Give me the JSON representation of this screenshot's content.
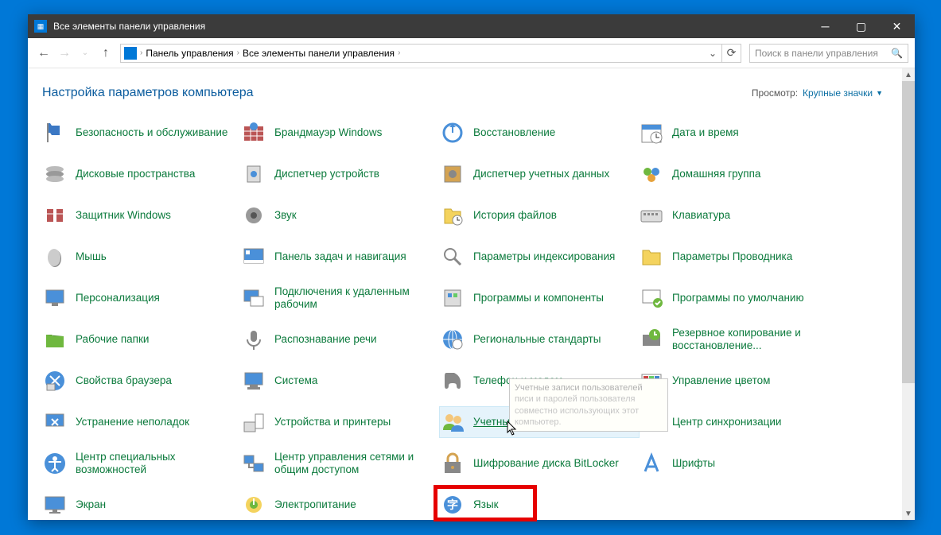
{
  "window": {
    "title": "Все элементы панели управления"
  },
  "breadcrumb": {
    "root": "Панель управления",
    "sub": "Все элементы панели управления"
  },
  "search": {
    "placeholder": "Поиск в панели управления"
  },
  "heading": "Настройка параметров компьютера",
  "view": {
    "label": "Просмотр:",
    "value": "Крупные значки"
  },
  "items": [
    {
      "label": "Безопасность и обслуживание",
      "icon": "flag"
    },
    {
      "label": "Брандмауэр Windows",
      "icon": "firewall"
    },
    {
      "label": "Восстановление",
      "icon": "recovery"
    },
    {
      "label": "Дата и время",
      "icon": "datetime"
    },
    {
      "label": "Дисковые пространства",
      "icon": "disks"
    },
    {
      "label": "Диспетчер устройств",
      "icon": "devmgr"
    },
    {
      "label": "Диспетчер учетных данных",
      "icon": "safe"
    },
    {
      "label": "Домашняя группа",
      "icon": "homegroup"
    },
    {
      "label": "Защитник Windows",
      "icon": "defender"
    },
    {
      "label": "Звук",
      "icon": "sound"
    },
    {
      "label": "История файлов",
      "icon": "filehistory"
    },
    {
      "label": "Клавиатура",
      "icon": "keyboard"
    },
    {
      "label": "Мышь",
      "icon": "mouse"
    },
    {
      "label": "Панель задач и навигация",
      "icon": "taskbar"
    },
    {
      "label": "Параметры индексирования",
      "icon": "index"
    },
    {
      "label": "Параметры Проводника",
      "icon": "folderopt"
    },
    {
      "label": "Персонализация",
      "icon": "personalize"
    },
    {
      "label": "Подключения к удаленным рабочим",
      "icon": "remote"
    },
    {
      "label": "Программы и компоненты",
      "icon": "programs"
    },
    {
      "label": "Программы по умолчанию",
      "icon": "defaultprog"
    },
    {
      "label": "Рабочие папки",
      "icon": "workfolders"
    },
    {
      "label": "Распознавание речи",
      "icon": "speech"
    },
    {
      "label": "Региональные стандарты",
      "icon": "region"
    },
    {
      "label": "Резервное копирование и восстановление...",
      "icon": "backup"
    },
    {
      "label": "Свойства браузера",
      "icon": "browser"
    },
    {
      "label": "Система",
      "icon": "system"
    },
    {
      "label": "Телефон и модем",
      "icon": "phone"
    },
    {
      "label": "Управление цветом",
      "icon": "color"
    },
    {
      "label": "Устранение неполадок",
      "icon": "troubleshoot"
    },
    {
      "label": "Устройства и принтеры",
      "icon": "devices"
    },
    {
      "label": "Учетные записи пользователей",
      "icon": "users",
      "hover": true
    },
    {
      "label": "Центр синхронизации",
      "icon": "sync"
    },
    {
      "label": "Центр специальных возможностей",
      "icon": "accessibility"
    },
    {
      "label": "Центр управления сетями и общим доступом",
      "icon": "network"
    },
    {
      "label": "Шифрование диска BitLocker",
      "icon": "bitlocker"
    },
    {
      "label": "Шрифты",
      "icon": "fonts"
    },
    {
      "label": "Экран",
      "icon": "display"
    },
    {
      "label": "Электропитание",
      "icon": "power"
    },
    {
      "label": "Язык",
      "icon": "language",
      "highlight": true
    }
  ],
  "tooltip": {
    "title": "Учетные записи пользователей",
    "body": "писи и паролей пользователя совместно использующих этот компьютер."
  }
}
